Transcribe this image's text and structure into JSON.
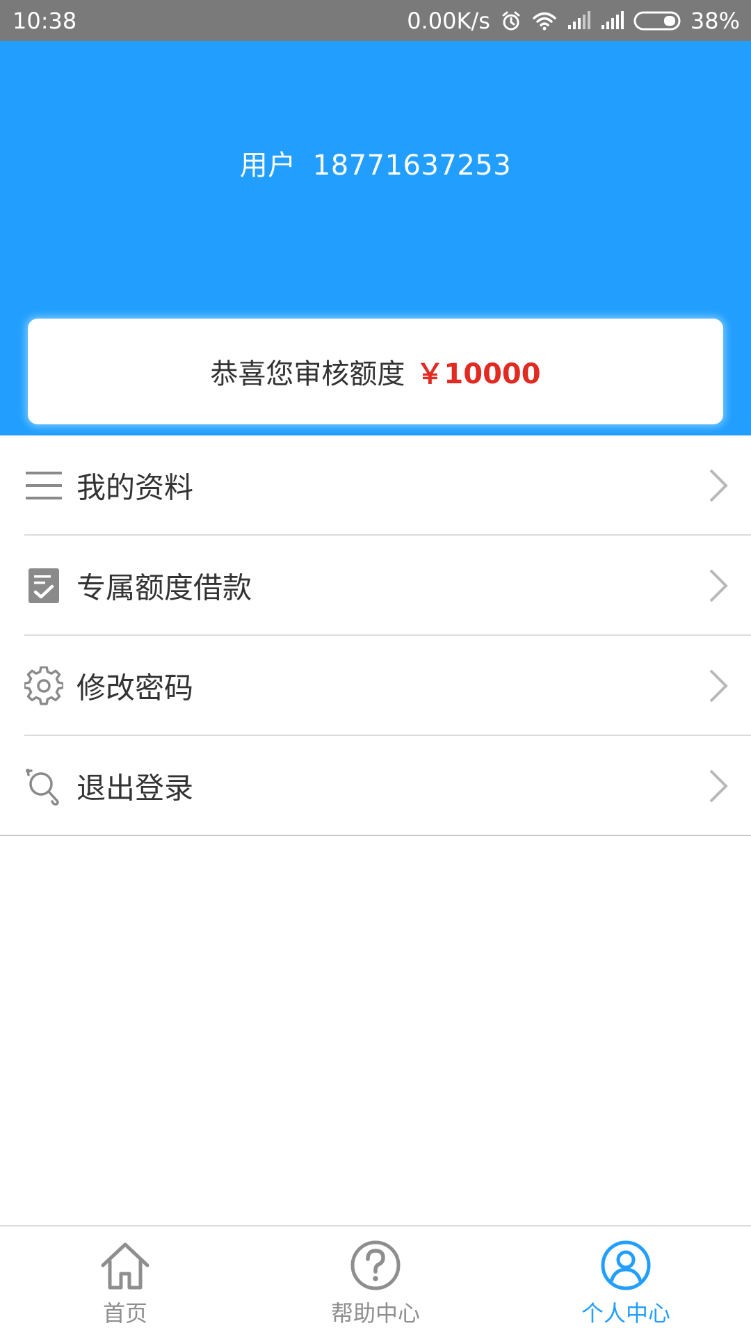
{
  "status_bar": {
    "time": "10:38",
    "network_speed": "0.00K/s",
    "battery": "38%",
    "icons": [
      "alarm-icon",
      "wifi-icon",
      "signal-icon",
      "signal-icon",
      "battery-icon"
    ]
  },
  "header": {
    "user_prefix": "用户",
    "phone": "18771637253",
    "background_color": "#229ffe"
  },
  "quota_card": {
    "label": "恭喜您审核额度",
    "amount": "￥10000",
    "amount_color": "#e02a22"
  },
  "menu": {
    "items": [
      {
        "label": "我的资料",
        "icon": "list-icon"
      },
      {
        "label": "专属额度借款",
        "icon": "checklist-icon"
      },
      {
        "label": "修改密码",
        "icon": "gear-icon"
      },
      {
        "label": "退出登录",
        "icon": "logout-icon"
      }
    ]
  },
  "bottom_nav": {
    "items": [
      {
        "label": "首页",
        "icon": "home-icon",
        "active": false
      },
      {
        "label": "帮助中心",
        "icon": "help-icon",
        "active": false
      },
      {
        "label": "个人中心",
        "icon": "user-icon",
        "active": true
      }
    ],
    "active_color": "#229ffe",
    "inactive_color": "#8e8e8e"
  }
}
